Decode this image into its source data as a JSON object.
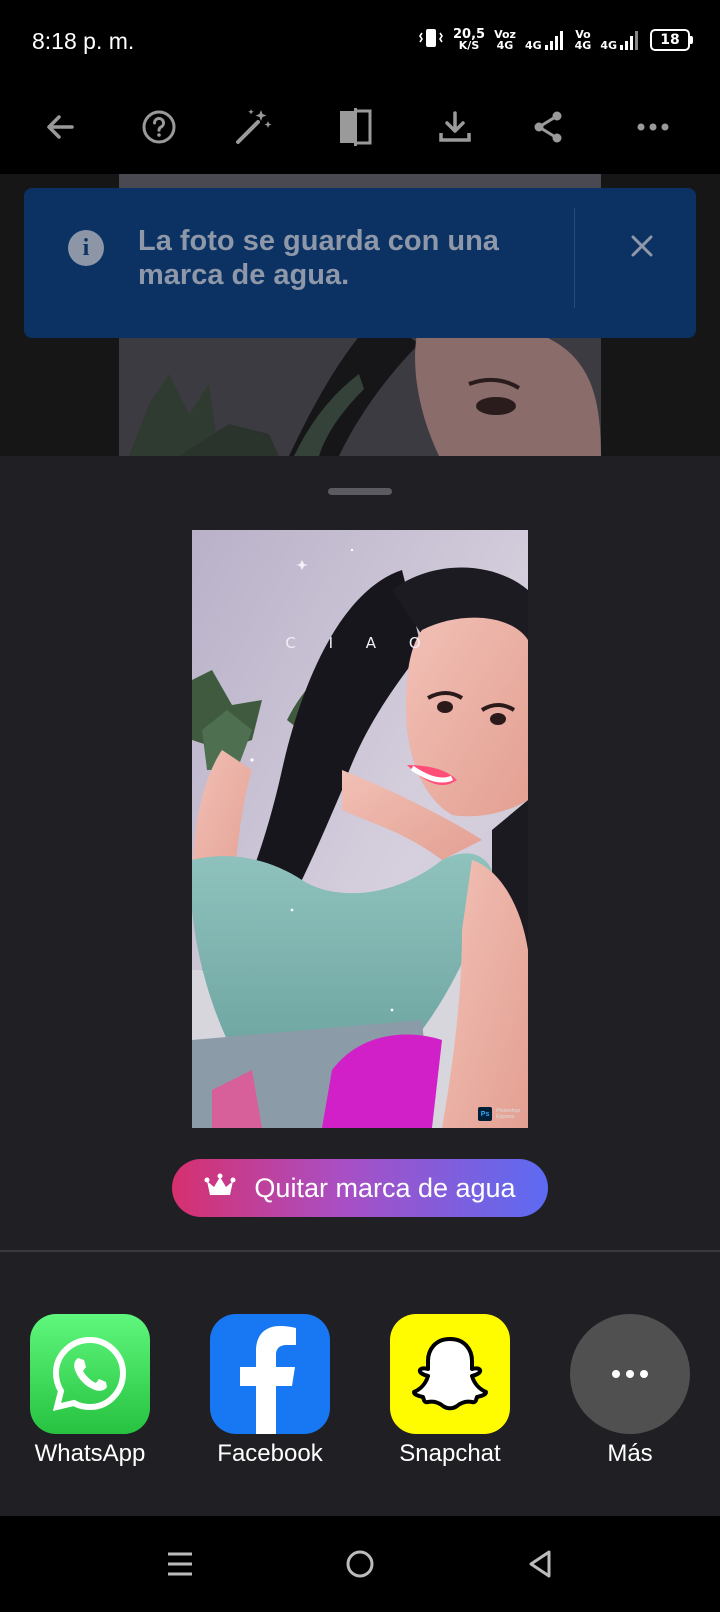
{
  "status_bar": {
    "time": "8:18 p. m.",
    "net_speed": "20,5",
    "net_unit": "K/S",
    "sim1_top": "Voz",
    "sim1_bottom": "4G",
    "sim1_type": "4G",
    "sim2_top": "Vo",
    "sim2_bottom": "4G",
    "sim2_type": "4G",
    "battery": "18"
  },
  "toolbar": {
    "icons": [
      "back-arrow-icon",
      "help-icon",
      "magic-wand-icon",
      "compare-icon",
      "download-icon",
      "share-icon",
      "more-icon"
    ]
  },
  "banner": {
    "message": "La foto se guarda con una marca de agua.",
    "color": "#0c3163"
  },
  "photo": {
    "overlay_text": "C I A O",
    "watermark_badge": "Ps",
    "watermark_line1": "Photoshop",
    "watermark_line2": "Express"
  },
  "remove_watermark": {
    "label": "Quitar marca de agua",
    "gradient": [
      "#d6306e",
      "#5c6bf2"
    ]
  },
  "share_targets": [
    {
      "label": "WhatsApp",
      "color": "#25d366",
      "icon": "whatsapp-icon"
    },
    {
      "label": "Facebook",
      "color": "#1877f2",
      "icon": "facebook-icon"
    },
    {
      "label": "Snapchat",
      "color": "#fffc00",
      "icon": "snapchat-icon"
    },
    {
      "label": "Más",
      "color": "#505050",
      "icon": "more-icon"
    }
  ]
}
